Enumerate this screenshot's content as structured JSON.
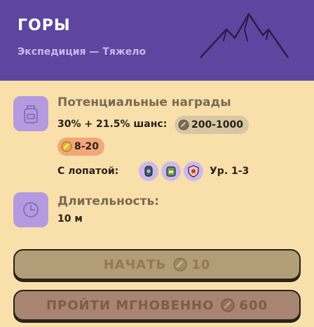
{
  "header": {
    "title": "ГОРЫ",
    "subtitle": "Экспедиция — Тяжело",
    "color": "#5e45a0"
  },
  "rewards": {
    "label": "Потенциальные награды",
    "chance_text": "30% + 21.5% шанс:",
    "coin_range": "200-1000",
    "gem_range": "8-20",
    "shovel_label": "С лопатой:",
    "level_text": "Ур. 1-3",
    "icon": "backpack-icon",
    "tools": [
      "gem-tool-icon",
      "green-bag-icon",
      "shield-tool-icon"
    ]
  },
  "duration": {
    "label": "Длительность:",
    "value": "10 м",
    "icon": "clock-icon"
  },
  "buttons": {
    "start_label": "НАЧАТЬ",
    "start_cost": "10",
    "instant_label": "ПРОЙТИ МГНОВЕННО",
    "instant_cost": "600"
  },
  "colors": {
    "background": "#f9e0ab",
    "icon_bg": "#b59ae0",
    "coin_pill": "#d6c8a3",
    "gem_pill": "#f3a779"
  }
}
